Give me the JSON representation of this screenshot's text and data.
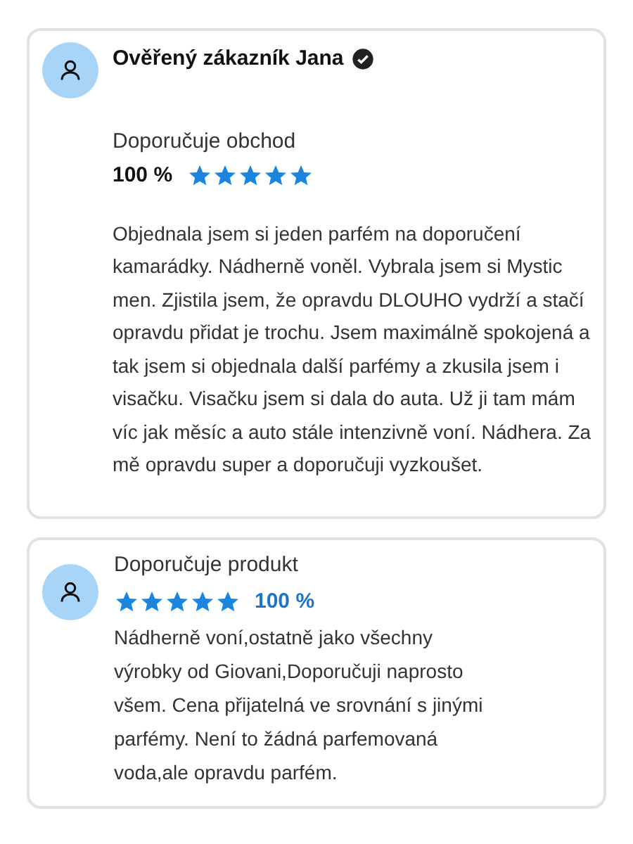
{
  "reviews": [
    {
      "kind": "store",
      "author": "Ověřený zákazník Jana",
      "verified": true,
      "recommendation": "Doporučuje obchod",
      "percent": "100 %",
      "stars": 5,
      "text": "Objednala jsem si jeden parfém na doporučení kamarádky. Nádherně voněl. Vybrala jsem si Mystic men. Zjistila jsem, že opravdu DLOUHO vydrží a stačí opravdu přidat je trochu. Jsem maximálně spokojená a tak jsem si objednala další parfémy a zkusila jsem i visačku. Visačku jsem si dala do auta. Už ji tam mám víc jak měsíc a auto stále intenzivně voní. Nádhera. Za mě opravdu super a doporučuji vyzkoušet."
    },
    {
      "kind": "product",
      "recommendation": "Doporučuje produkt",
      "percent": "100 %",
      "stars": 5,
      "text": "Nádherně voní,ostatně jako všechny výrobky od Giovani,Doporučuji naprosto všem. Cena přijatelná ve srovnání s jinými parfémy. Není to žádná parfemovaná voda,ale opravdu parfém."
    }
  ]
}
